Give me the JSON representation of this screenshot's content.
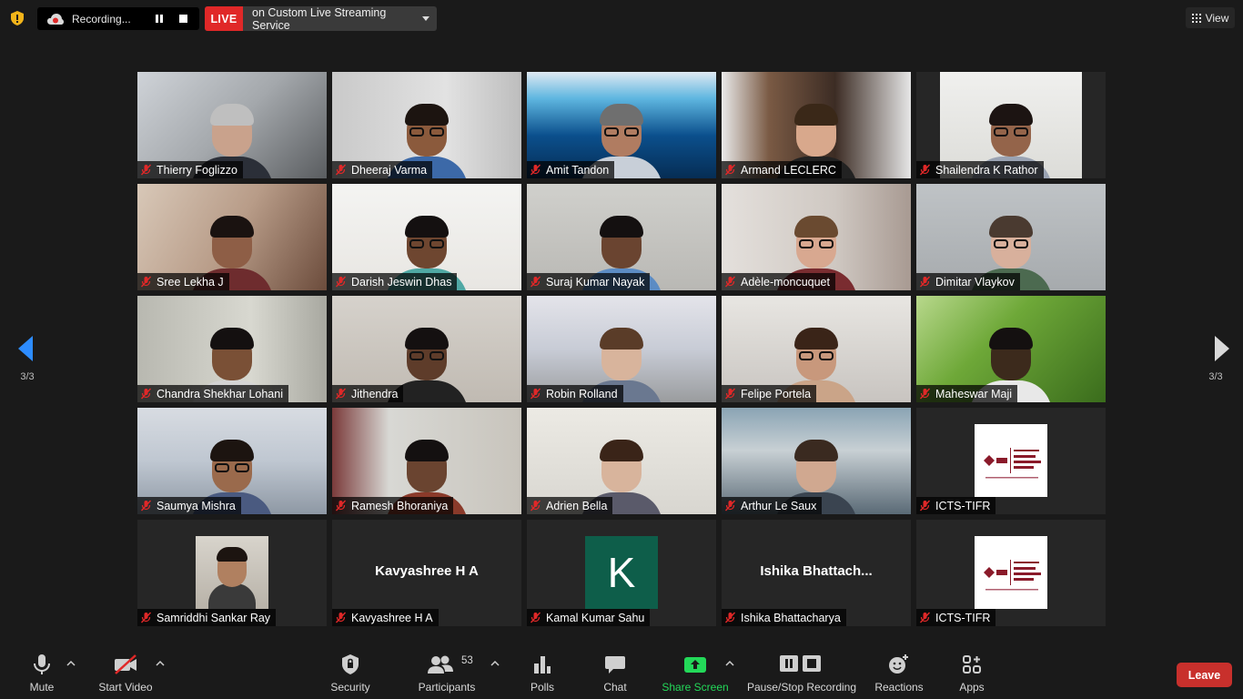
{
  "top_bar": {
    "recording_label": "Recording...",
    "live_tag": "LIVE",
    "live_service": "on Custom Live Streaming Service",
    "view_label": "View"
  },
  "participants": [
    {
      "name": "Thierry Foglizzo"
    },
    {
      "name": "Dheeraj Varma"
    },
    {
      "name": "Amit Tandon"
    },
    {
      "name": "Armand LECLERC"
    },
    {
      "name": "Shailendra K Rathor"
    },
    {
      "name": "Sree Lekha J"
    },
    {
      "name": "Darish Jeswin Dhas"
    },
    {
      "name": "Suraj Kumar Nayak"
    },
    {
      "name": "Adèle-moncuquet"
    },
    {
      "name": "Dimitar Vlaykov"
    },
    {
      "name": "Chandra Shekhar Lohani"
    },
    {
      "name": "Jithendra"
    },
    {
      "name": "Robin Rolland"
    },
    {
      "name": "Felipe Portela"
    },
    {
      "name": "Maheswar Maji"
    },
    {
      "name": "Saumya Mishra"
    },
    {
      "name": "Ramesh Bhoraniya"
    },
    {
      "name": "Adrien Bella"
    },
    {
      "name": "Arthur Le Saux"
    },
    {
      "name": "ICTS-TIFR",
      "logo_text": "ICTS INTERNATIONAL CENTRE for THEORETICAL SCIENCES"
    },
    {
      "name": "Samriddhi Sankar Ray"
    },
    {
      "name": "Kavyashree H A",
      "display": "Kavyashree H A"
    },
    {
      "name": "Kamal Kumar Sahu",
      "initial": "K"
    },
    {
      "name": "Ishika Bhattacharya",
      "display": "Ishika  Bhattach..."
    },
    {
      "name": "ICTS-TIFR",
      "logo_text": "ICTS INTERNATIONAL CENTRE for THEORETICAL SCIENCES"
    }
  ],
  "pagination": {
    "left": "3/3",
    "right": "3/3"
  },
  "toolbar": {
    "mute": "Mute",
    "start_video": "Start Video",
    "security": "Security",
    "participants": "Participants",
    "participants_count": "53",
    "polls": "Polls",
    "chat": "Chat",
    "share_screen": "Share Screen",
    "pause_stop_recording": "Pause/Stop Recording",
    "reactions": "Reactions",
    "apps": "Apps",
    "leave": "Leave"
  },
  "colors": {
    "live_red": "#e02828",
    "share_green": "#23d959",
    "leave_red": "#c8302c",
    "accent_blue": "#2d8cff"
  }
}
